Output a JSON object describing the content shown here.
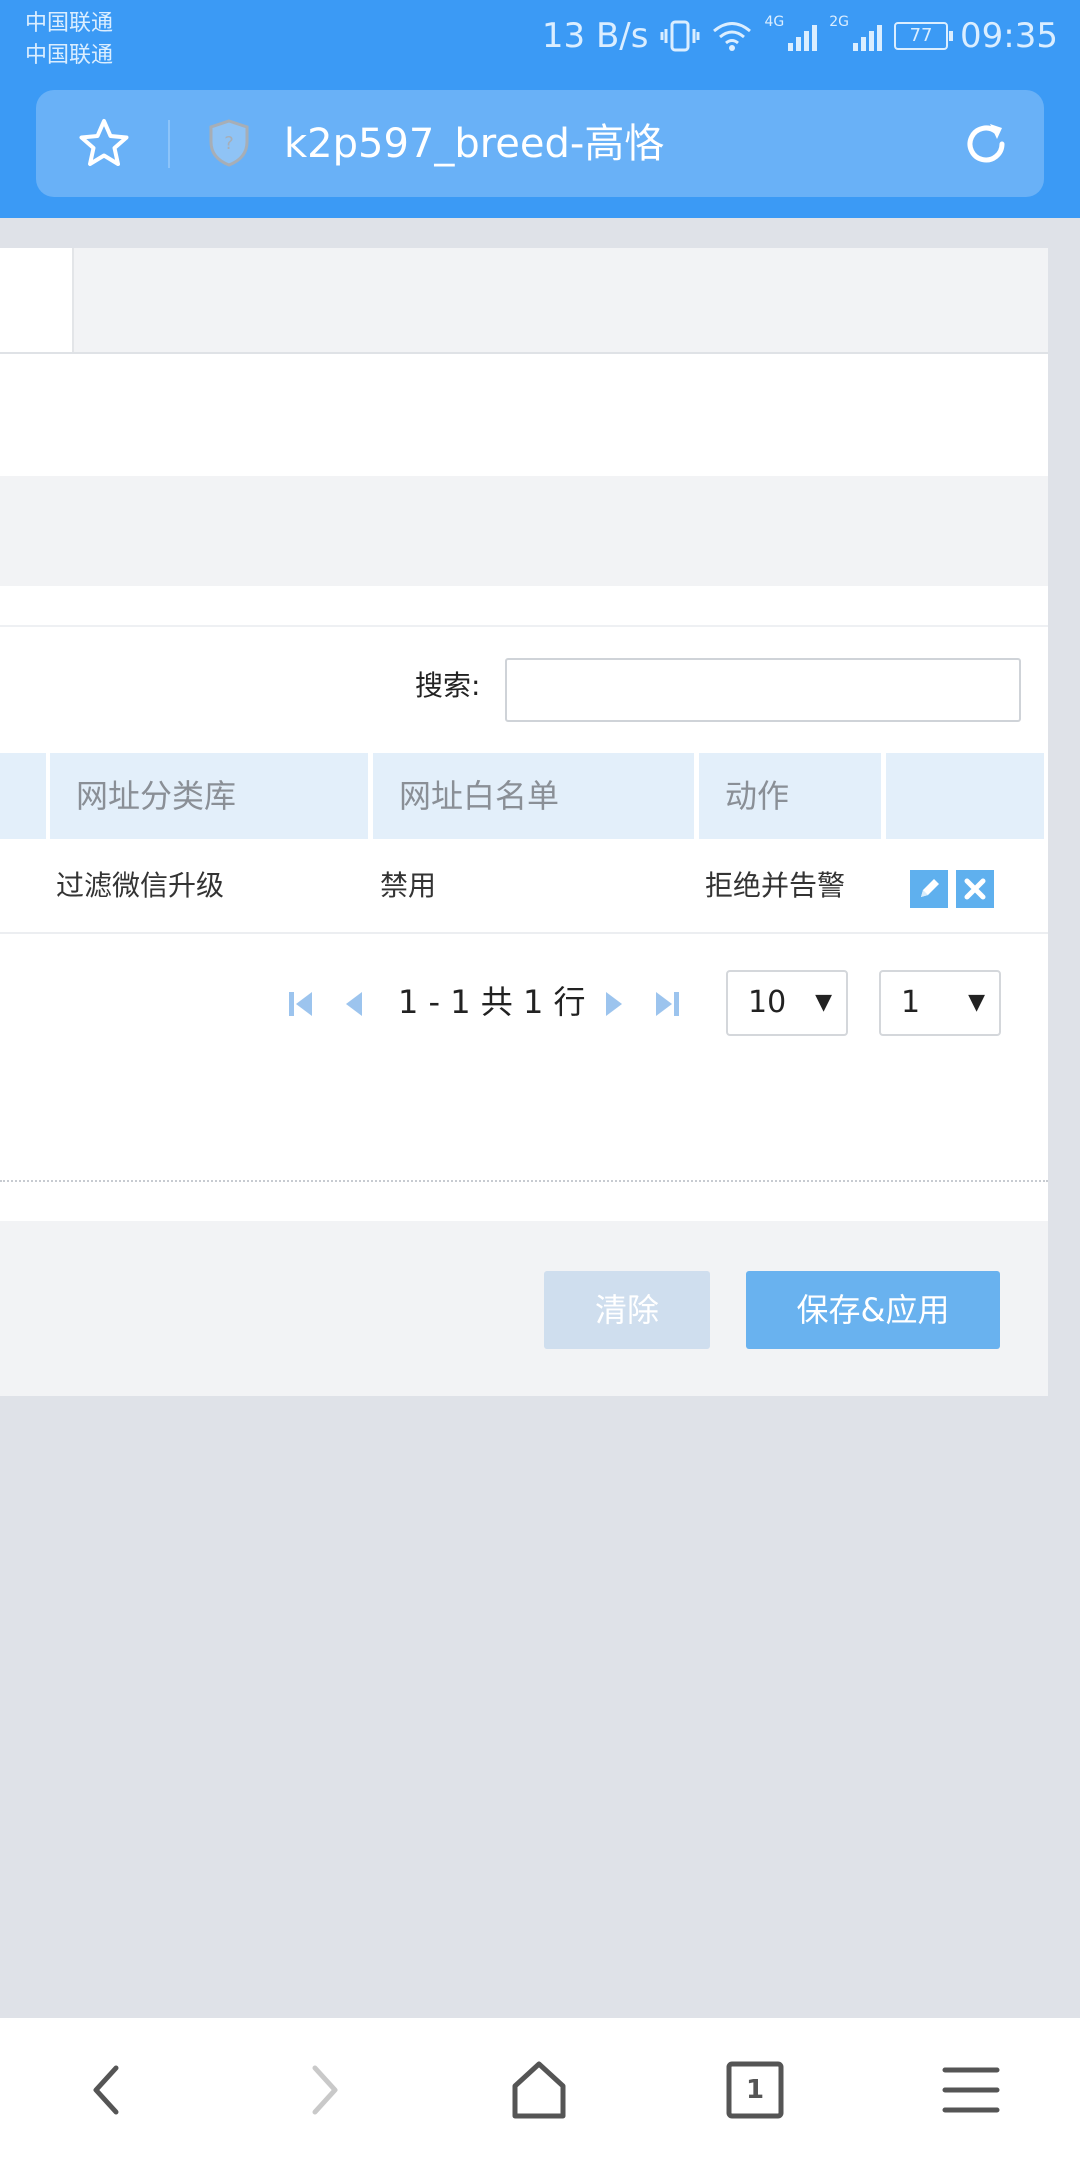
{
  "status_bar": {
    "carrier_1": "中国联通",
    "carrier_2": "中国联通",
    "speed": "13 B/s",
    "net_1": "4G",
    "net_2": "2G",
    "battery": "77",
    "time": "09:35"
  },
  "browser": {
    "page_title": "k2p597_breed-高恪",
    "icons": [
      "star-icon",
      "shield-icon",
      "reload-icon"
    ]
  },
  "search": {
    "label": "搜索:",
    "placeholder": "",
    "value": ""
  },
  "table": {
    "columns": [
      "网址分类库",
      "网址白名单",
      "动作",
      ""
    ],
    "rows": [
      {
        "category": "过滤微信升级",
        "whitelist": "禁用",
        "action": "拒绝并告警"
      }
    ]
  },
  "pagination": {
    "summary": "1 - 1 共 1 行",
    "page_size": "10",
    "page": "1"
  },
  "buttons": {
    "clear": "清除",
    "save_apply": "保存&应用"
  },
  "colors": {
    "accent": "#3b9af5",
    "header_bg": "#e3effa",
    "save_button": "#69b2ef",
    "clear_button": "#cfdeee"
  },
  "bottom_nav": {
    "tab_count": "1",
    "icons": [
      "back-icon",
      "forward-icon",
      "home-icon",
      "tabs-icon",
      "menu-icon"
    ]
  }
}
